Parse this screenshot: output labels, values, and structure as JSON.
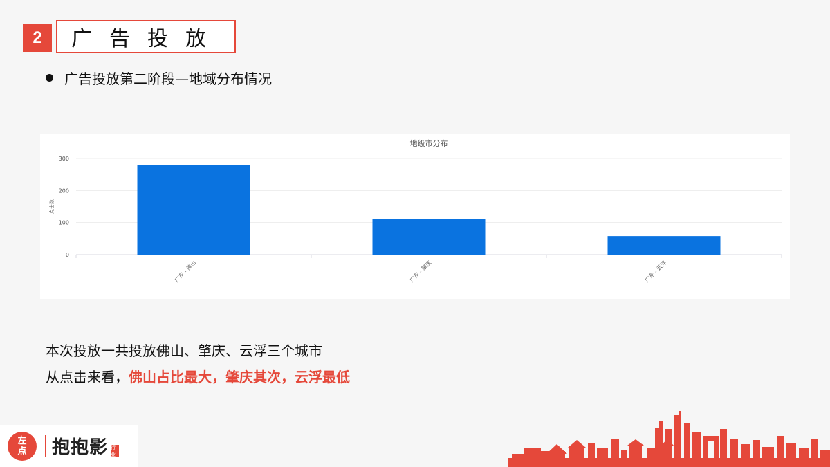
{
  "header": {
    "section_number": "2",
    "title": "广告投放"
  },
  "bullet": {
    "text": "广告投放第二阶段—地域分布情况"
  },
  "chart_data": {
    "type": "bar",
    "title": "地级市分布",
    "ylabel": "点击数",
    "xlabel": "",
    "categories": [
      "广东 - 佛山",
      "广东 - 肇庆",
      "广东 - 云浮"
    ],
    "values": [
      280,
      112,
      58
    ],
    "ylim": [
      0,
      300
    ],
    "yticks": [
      0,
      100,
      200,
      300
    ],
    "grid": true,
    "bar_color": "#0a73e0"
  },
  "summary": {
    "line1": "本次投放一共投放佛山、肇庆、云浮三个城市",
    "line2_prefix": "从点击来看，",
    "line2_highlight": "佛山占比最大，肇庆其次，云浮最低"
  },
  "logo": {
    "circle_top": "左",
    "circle_bottom": "点",
    "brand": "抱抱影",
    "tag": "行业"
  },
  "colors": {
    "accent": "#e5483a",
    "bar": "#0a73e0"
  }
}
